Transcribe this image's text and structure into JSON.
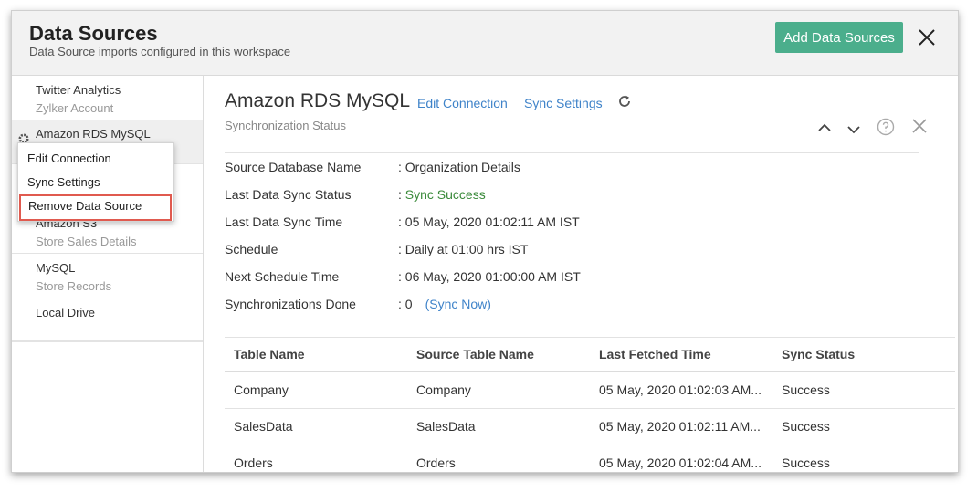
{
  "dialog": {
    "title": "Data Sources",
    "subtitle": "Data Source imports configured in this workspace",
    "add_button": "Add Data Sources",
    "accent_color": "#4bae8c"
  },
  "sidebar": {
    "items": [
      {
        "name": "Twitter Analytics",
        "sub": "Zylker Account"
      },
      {
        "name": "Amazon RDS MySQL",
        "sub": ""
      },
      {
        "name": "Amazon S3",
        "sub": "Store Sales Details"
      },
      {
        "name": "MySQL",
        "sub": "Store Records"
      },
      {
        "name": "Local Drive",
        "sub": ""
      }
    ]
  },
  "context_menu": {
    "items": [
      "Edit Connection",
      "Sync Settings",
      "Remove Data Source"
    ],
    "highlighted": "Remove Data Source",
    "highlight_color": "#e05a4f"
  },
  "main": {
    "title": "Amazon RDS MySQL",
    "edit_connection": "Edit Connection",
    "sync_settings": "Sync Settings",
    "section_label": "Synchronization Status",
    "properties": [
      {
        "label": "Source Database Name",
        "value": ": Organization Details"
      },
      {
        "label": "Last Data Sync Status",
        "sep": ": ",
        "value": "Sync Success"
      },
      {
        "label": "Last Data Sync Time",
        "value": ": 05 May, 2020 01:02:11 AM IST"
      },
      {
        "label": "Schedule",
        "sep": ": ",
        "bold": "Daily",
        "value": " at 01:00 hrs IST"
      },
      {
        "label": "Next Schedule Time",
        "value": ": 06 May, 2020 01:00:00 AM IST"
      },
      {
        "label": "Synchronizations Done",
        "value": ": 0",
        "link": "(Sync Now)"
      }
    ],
    "table": {
      "columns": [
        "Table Name",
        "Source Table Name",
        "Last Fetched Time",
        "Sync Status"
      ],
      "rows": [
        [
          "Company",
          "Company",
          "05 May, 2020 01:02:03 AM...",
          "Success"
        ],
        [
          "SalesData",
          "SalesData",
          "05 May, 2020 01:02:11 AM...",
          "Success"
        ],
        [
          "Orders",
          "Orders",
          "05 May, 2020 01:02:04 AM...",
          "Success"
        ]
      ]
    }
  }
}
